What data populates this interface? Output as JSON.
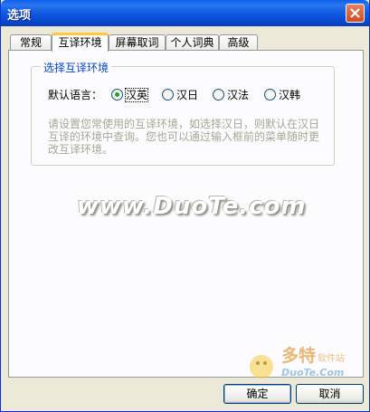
{
  "window": {
    "title": "选项"
  },
  "tabs": [
    {
      "label": "常规"
    },
    {
      "label": "互译环境",
      "active": true
    },
    {
      "label": "屏幕取词"
    },
    {
      "label": "个人词典"
    },
    {
      "label": "高级"
    }
  ],
  "group": {
    "title": "选择互译环境",
    "lang_label": "默认语言：",
    "options": [
      {
        "label": "汉英",
        "checked": true
      },
      {
        "label": "汉日",
        "checked": false
      },
      {
        "label": "汉法",
        "checked": false
      },
      {
        "label": "汉韩",
        "checked": false
      }
    ],
    "description": "请设置您常使用的互译环境，如选择汉日，则默认在汉日互译的环境中查询。您也可以通过输入框前的菜单随时更改互译环境。"
  },
  "watermark": {
    "text": "www.DuoTe.com"
  },
  "logo": {
    "brand": "多特",
    "sub": "软件站",
    "url": "DuoTe.Com"
  },
  "buttons": {
    "ok": "确定",
    "cancel": "取消"
  },
  "colors": {
    "title_bar": "#0A5FEA",
    "group_title": "#0046D5",
    "radio_dot": "#21A121",
    "tab_highlight": "#FFC83C"
  }
}
